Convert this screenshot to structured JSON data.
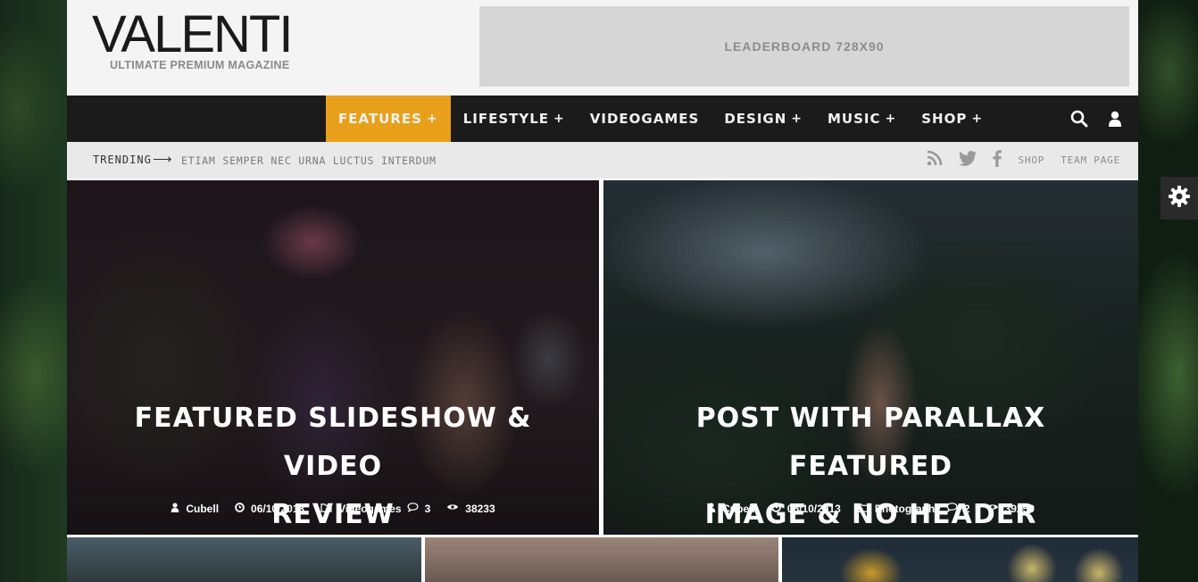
{
  "header": {
    "logo_title": "VALENTI",
    "logo_subtitle": "ULTIMATE PREMIUM MAGAZINE",
    "leaderboard_label": "LEADERBOARD 728X90"
  },
  "nav": {
    "items": [
      {
        "label": "FEATURES",
        "has_submenu": true,
        "active": true
      },
      {
        "label": "LIFESTYLE",
        "has_submenu": true,
        "active": false
      },
      {
        "label": "VIDEOGAMES",
        "has_submenu": false,
        "active": false
      },
      {
        "label": "DESIGN",
        "has_submenu": true,
        "active": false
      },
      {
        "label": "MUSIC",
        "has_submenu": true,
        "active": false
      },
      {
        "label": "SHOP",
        "has_submenu": true,
        "active": false
      }
    ],
    "plus": "+",
    "icons": [
      "search-icon",
      "user-icon"
    ]
  },
  "trending": {
    "label": "TRENDING",
    "arrow": "⟶",
    "headline": "ETIAM SEMPER NEC URNA LUCTUS INTERDUM",
    "links": [
      "SHOP",
      "TEAM PAGE"
    ],
    "social_icons": [
      "rss-icon",
      "twitter-icon",
      "facebook-icon"
    ]
  },
  "featured": [
    {
      "title_lines": [
        "FEATURED SLIDESHOW & VIDEO",
        "REVIEW"
      ],
      "author": "Cubell",
      "date": "06/10/2013",
      "category": "Videogames",
      "comments": "3",
      "views": "38233"
    },
    {
      "title_lines": [
        "POST WITH PARALLAX FEATURED",
        "IMAGE & NO HEADER"
      ],
      "author": "Cubell",
      "date": "06/10/2013",
      "category": "Photography",
      "comments": "2",
      "views": "39259"
    }
  ],
  "colors": {
    "accent": "#e8a01a",
    "nav_bg": "#1b1b1b",
    "trend_bg": "#e9e9e9",
    "header_bg": "#f4f4f4",
    "leaderboard_bg": "#d6d6d6"
  }
}
